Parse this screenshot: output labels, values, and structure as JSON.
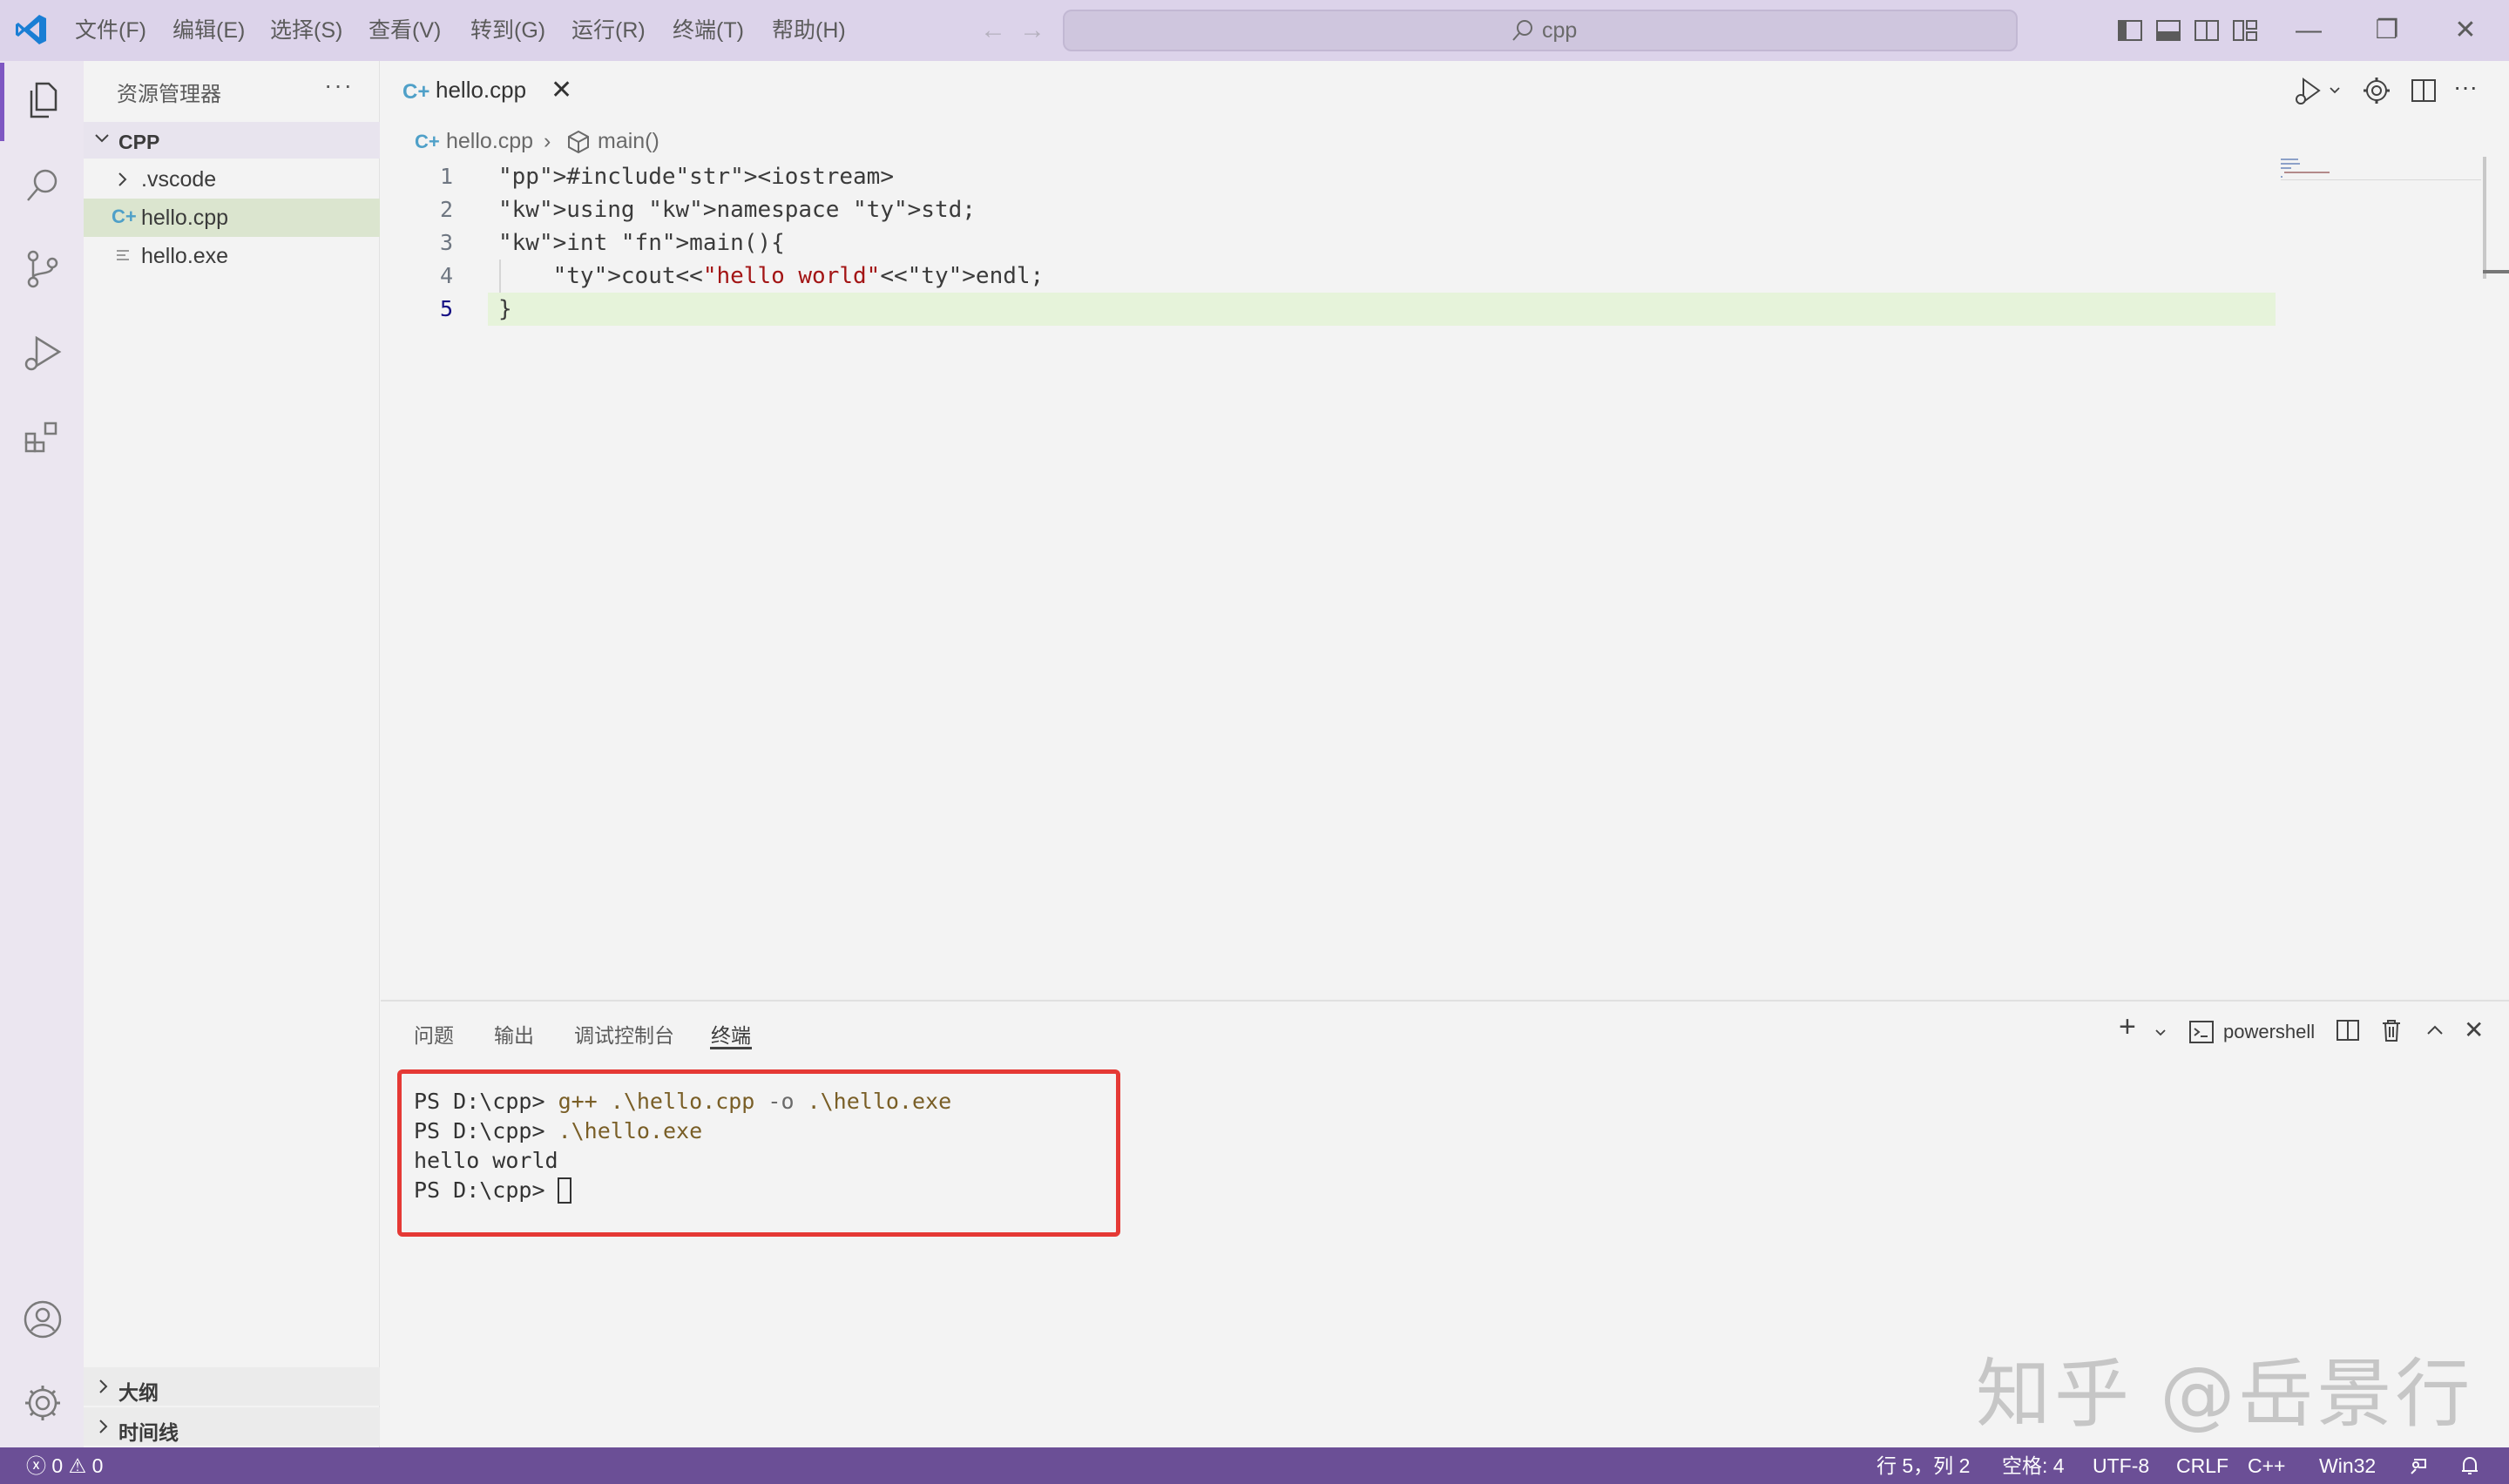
{
  "menu": [
    "文件(F)",
    "编辑(E)",
    "选择(S)",
    "查看(V)",
    "转到(G)",
    "运行(R)",
    "终端(T)",
    "帮助(H)"
  ],
  "command_center": {
    "text": "cpp",
    "icon": "search-icon"
  },
  "sidebar": {
    "title": "资源管理器",
    "folder": "CPP",
    "items": [
      {
        "label": ".vscode",
        "icon": "chevron-right-icon"
      },
      {
        "label": "hello.cpp",
        "icon": "cpp-file-icon"
      },
      {
        "label": "hello.exe",
        "icon": "file-lines-icon"
      }
    ],
    "sections": [
      "大纲",
      "时间线"
    ]
  },
  "editor": {
    "tab": "hello.cpp",
    "breadcrumb": {
      "file": "hello.cpp",
      "symbol": "main()"
    },
    "line_numbers": [
      "1",
      "2",
      "3",
      "4",
      "5"
    ],
    "code": [
      "#include<iostream>",
      "using namespace std;",
      "int main(){",
      "    cout<<\"hello world\"<<endl;",
      "}"
    ]
  },
  "panel": {
    "tabs": [
      "问题",
      "输出",
      "调试控制台",
      "终端"
    ],
    "active_tab": "终端",
    "shell": "powershell",
    "terminal": {
      "prompt": "PS D:\\cpp> ",
      "cmd1": "g++ .\\hello.cpp -o .\\hello.exe",
      "cmd2": ".\\hello.exe",
      "output": "hello world"
    }
  },
  "watermark": "知乎 @岳景行",
  "statusbar": {
    "errors": "0",
    "warnings": "0",
    "position": "行 5，列 2",
    "spaces": "空格: 4",
    "encoding": "UTF-8",
    "eol": "CRLF",
    "language": "C++",
    "platform": "Win32"
  },
  "colors": {
    "titlebar": "#dcd3ea",
    "statusbar": "#6b4f96",
    "highlight_box": "#e53935",
    "current_line": "#e6f3da"
  }
}
